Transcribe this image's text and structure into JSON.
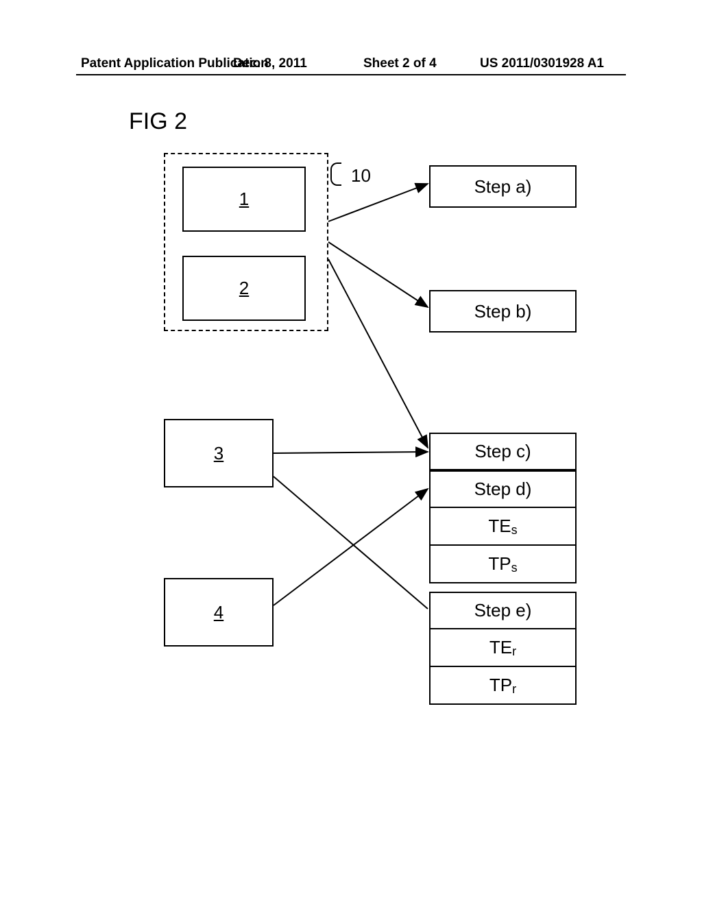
{
  "header": {
    "left": "Patent Application Publication",
    "date": "Dec. 8, 2011",
    "sheet": "Sheet 2 of 4",
    "pubno": "US 2011/0301928 A1"
  },
  "figure_label": "FIG 2",
  "ref_label": "10",
  "boxes": {
    "b1": "1",
    "b2": "2",
    "b3": "3",
    "b4": "4"
  },
  "steps": {
    "a": "Step a)",
    "b": "Step b)",
    "c": "Step c)",
    "d": {
      "label": "Step d)",
      "row1_base": "TE",
      "row1_sub": "s",
      "row2_base": "TP",
      "row2_sub": "s"
    },
    "e": {
      "label": "Step e)",
      "row1_base": "TE",
      "row1_sub": "r",
      "row2_base": "TP",
      "row2_sub": "r"
    }
  }
}
